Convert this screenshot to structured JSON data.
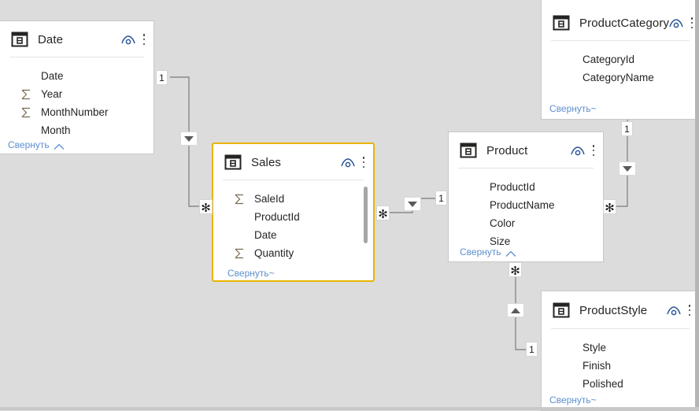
{
  "canvas": {
    "background": "#dcdcdc",
    "selection_color": "#e8b500",
    "link_color": "#5b8fd0",
    "text_color": "#252423"
  },
  "tables": [
    {
      "id": "date",
      "name": "Date",
      "icon": "table-icon",
      "eye_icon": "eye-icon",
      "menu_icon": "kebab-menu-icon",
      "collapse_label": "Свернуть",
      "selected": false,
      "fields": [
        {
          "name": "Date",
          "numeric": false
        },
        {
          "name": "Year",
          "numeric": true
        },
        {
          "name": "MonthNumber",
          "numeric": true
        },
        {
          "name": "Month",
          "numeric": false
        }
      ]
    },
    {
      "id": "sales",
      "name": "Sales",
      "icon": "table-icon",
      "eye_icon": "eye-icon",
      "menu_icon": "kebab-menu-icon",
      "collapse_label": "Свернуть~",
      "selected": true,
      "fields": [
        {
          "name": "SaleId",
          "numeric": true
        },
        {
          "name": "ProductId",
          "numeric": false
        },
        {
          "name": "Date",
          "numeric": false
        },
        {
          "name": "Quantity",
          "numeric": true
        }
      ]
    },
    {
      "id": "product",
      "name": "Product",
      "icon": "table-icon",
      "eye_icon": "eye-icon",
      "menu_icon": "kebab-menu-icon",
      "collapse_label": "Свернуть",
      "selected": false,
      "fields": [
        {
          "name": "ProductId",
          "numeric": false
        },
        {
          "name": "ProductName",
          "numeric": false
        },
        {
          "name": "Color",
          "numeric": false
        },
        {
          "name": "Size",
          "numeric": false
        }
      ]
    },
    {
      "id": "productcategory",
      "name": "ProductCategory",
      "icon": "table-icon",
      "eye_icon": "eye-icon",
      "menu_icon": "kebab-menu-icon",
      "collapse_label": "Свернуть~",
      "selected": false,
      "fields": [
        {
          "name": "CategoryId",
          "numeric": false
        },
        {
          "name": "CategoryName",
          "numeric": false
        }
      ]
    },
    {
      "id": "productstyle",
      "name": "ProductStyle",
      "icon": "table-icon",
      "eye_icon": "eye-icon",
      "menu_icon": "kebab-menu-icon",
      "collapse_label": "Свернуть~",
      "selected": false,
      "fields": [
        {
          "name": "Style",
          "numeric": false
        },
        {
          "name": "Finish",
          "numeric": false
        },
        {
          "name": "Polished",
          "numeric": false
        }
      ]
    }
  ],
  "relationships": [
    {
      "id": "date-sales",
      "from_table": "Date",
      "to_table": "Sales",
      "from_cardinality": "1",
      "to_cardinality": "*",
      "filter_direction": "down"
    },
    {
      "id": "sales-product",
      "from_table": "Product",
      "to_table": "Sales",
      "from_cardinality": "1",
      "to_cardinality": "*",
      "filter_direction": "down"
    },
    {
      "id": "productcategory-product",
      "from_table": "ProductCategory",
      "to_table": "Product",
      "from_cardinality": "1",
      "to_cardinality": "*",
      "filter_direction": "down"
    },
    {
      "id": "product-productstyle",
      "from_table": "ProductStyle",
      "to_table": "Product",
      "from_cardinality": "1",
      "to_cardinality": "*",
      "filter_direction": "up"
    }
  ],
  "badges": {
    "one": "1",
    "many": "✻"
  }
}
